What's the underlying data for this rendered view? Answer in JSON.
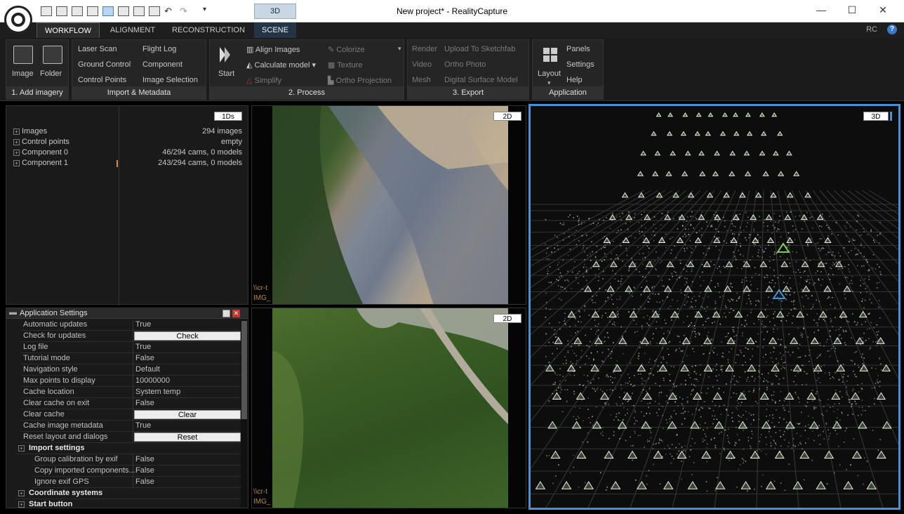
{
  "window": {
    "title": "New project* - RealityCapture",
    "scene_context": "3D"
  },
  "tabs": [
    "WORKFLOW",
    "ALIGNMENT",
    "RECONSTRUCTION",
    "SCENE"
  ],
  "tabs_right": {
    "rc": "RC",
    "help": "?"
  },
  "ribbon": {
    "add_imagery": {
      "title": "1. Add imagery",
      "image": "Image",
      "folder": "Folder"
    },
    "import": {
      "title": "Import & Metadata",
      "laser_scan": "Laser Scan",
      "flight_log": "Flight Log",
      "ground_control": "Ground Control",
      "component": "Component",
      "control_points": "Control Points",
      "image_selection": "Image Selection"
    },
    "process": {
      "title": "2. Process",
      "start": "Start",
      "align_images": "Align Images",
      "calculate_model": "Calculate model",
      "simplify": "Simplify",
      "colorize": "Colorize",
      "texture": "Texture",
      "ortho_projection": "Ortho Projection"
    },
    "export": {
      "title": "3. Export",
      "render": "Render",
      "video": "Video",
      "mesh": "Mesh",
      "upload": "Upload To Sketchfab",
      "ortho_photo": "Ortho Photo",
      "dsm": "Digital Surface Model"
    },
    "application": {
      "title": "Application",
      "layout": "Layout",
      "panels": "Panels",
      "settings": "Settings",
      "help": "Help"
    }
  },
  "tree": {
    "badge": "1Ds",
    "rows": [
      {
        "label": "Images",
        "value": "294 images"
      },
      {
        "label": "Control points",
        "value": "empty"
      },
      {
        "label": "Component 0",
        "value": "46/294 cams, 0 models"
      },
      {
        "label": "Component 1",
        "value": "243/294 cams, 0 models"
      }
    ]
  },
  "viewports": {
    "top_badge": "2D",
    "bottom_badge": "2D",
    "scene_badge": "3D",
    "top_path": "\\\\cr-t",
    "top_file": "IMG_",
    "bottom_path": "\\\\cr-t",
    "bottom_file": "IMG_"
  },
  "settings": {
    "title": "Application Settings",
    "rows": [
      {
        "key": "Automatic updates",
        "value": "True"
      },
      {
        "key": "Check for updates",
        "button": "Check"
      },
      {
        "key": "Log file",
        "value": "True"
      },
      {
        "key": "Tutorial mode",
        "value": "False"
      },
      {
        "key": "Navigation style",
        "value": "Default"
      },
      {
        "key": "Max points to display",
        "value": "10000000"
      },
      {
        "key": "Cache location",
        "value": "System temp"
      },
      {
        "key": "Clear cache on exit",
        "value": "False"
      },
      {
        "key": "Clear cache",
        "button": "Clear"
      },
      {
        "key": "Cache image metadata",
        "value": "True"
      },
      {
        "key": "Reset layout and dialogs",
        "button": "Reset"
      }
    ],
    "import_section": "Import settings",
    "import_rows": [
      {
        "key": "Group calibration by exif",
        "value": "False"
      },
      {
        "key": "Copy imported components...",
        "value": "False"
      },
      {
        "key": "Ignore exif GPS",
        "value": "False"
      }
    ],
    "coord_section": "Coordinate systems",
    "start_section": "Start button"
  }
}
